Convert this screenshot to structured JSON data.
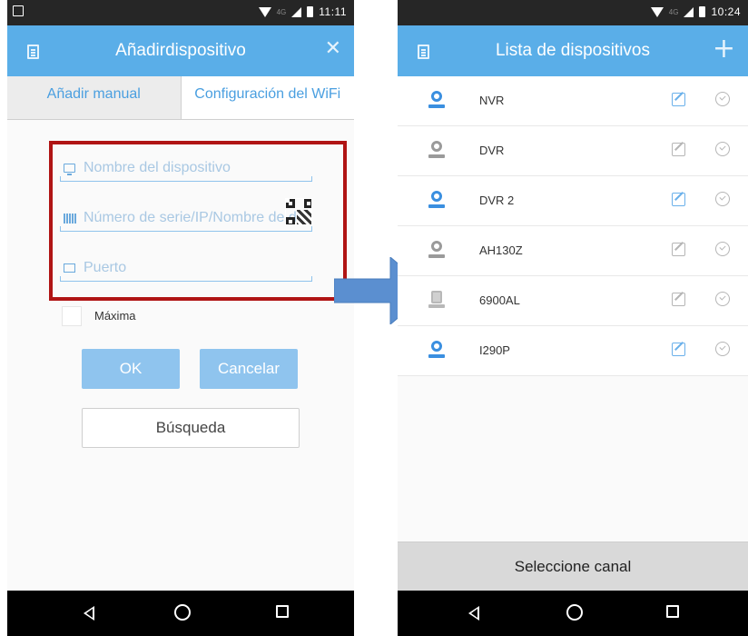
{
  "left_screen": {
    "status": {
      "time": "11:11",
      "network": "4G"
    },
    "title": "Añadirdispositivo",
    "tabs": [
      {
        "label": "Añadir manual",
        "active": true
      },
      {
        "label": "Configuración del WiFi",
        "active": false
      }
    ],
    "fields": [
      {
        "placeholder": "Nombre del dispositivo",
        "value": "",
        "icon": "monitor-icon"
      },
      {
        "placeholder": "Número de serie/IP/Nombre de dominio",
        "value": "",
        "icon": "barcode-icon"
      },
      {
        "placeholder": "Puerto",
        "value": "",
        "icon": "port-icon"
      }
    ],
    "checkbox_label": "Máxima",
    "ok_label": "OK",
    "cancel_label": "Cancelar",
    "search_label": "Búsqueda"
  },
  "right_screen": {
    "status": {
      "time": "10:24",
      "network": "4G"
    },
    "title": "Lista de dispositivos",
    "devices": [
      {
        "name": "NVR",
        "online": true,
        "icon": "camera-icon"
      },
      {
        "name": "DVR",
        "online": false,
        "icon": "camera-icon"
      },
      {
        "name": "DVR 2",
        "online": true,
        "icon": "camera-icon"
      },
      {
        "name": "AH130Z",
        "online": false,
        "icon": "camera-icon"
      },
      {
        "name": "6900AL",
        "online": false,
        "icon": "dvr-icon"
      },
      {
        "name": "I290P",
        "online": true,
        "icon": "camera-icon"
      }
    ],
    "select_channel_label": "Seleccione canal"
  },
  "colors": {
    "titlebar": "#5aaee8",
    "accent_blue": "#3a8fe0",
    "highlight_red": "#b01414",
    "arrow_blue": "#5b8fd0"
  }
}
